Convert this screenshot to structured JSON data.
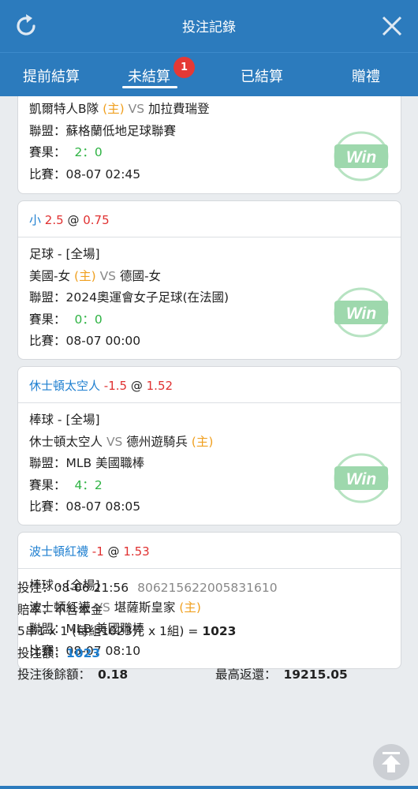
{
  "header": {
    "title": "投注記錄",
    "refresh_icon": "refresh-icon",
    "close_icon": "close-icon"
  },
  "tabs": [
    {
      "label": "提前結算",
      "active": false
    },
    {
      "label": "未結算",
      "active": true,
      "badge": "1"
    },
    {
      "label": "已結算",
      "active": false
    },
    {
      "label": "贈禮",
      "active": false
    }
  ],
  "card1": {
    "home": "凱爾特人B隊",
    "home_tag": "(主)",
    "vs": "VS",
    "away": "加拉費瑞登",
    "league_label": "聯盟：",
    "league": "蘇格蘭低地足球聯賽",
    "result_label": "賽果：",
    "result": "2：0",
    "time_label": "比賽：",
    "time": "08-07 02:45",
    "stamp": "Win"
  },
  "card2": {
    "pick": "小",
    "line": "2.5",
    "at": "@",
    "odds": "0.75",
    "sport": "足球 - [全場]",
    "home": "美國-女",
    "home_tag": "(主)",
    "vs": "VS",
    "away": "德國-女",
    "league_label": "聯盟：",
    "league": "2024奧運會女子足球(在法國)",
    "result_label": "賽果：",
    "result": "0：0",
    "time_label": "比賽：",
    "time": "08-07 00:00",
    "stamp": "Win"
  },
  "card3": {
    "pick": "休士頓太空人",
    "line": "-1.5",
    "at": "@",
    "odds": "1.52",
    "sport": "棒球 - [全場]",
    "home": "休士頓太空人",
    "vs": "VS",
    "away": "德州遊騎兵",
    "away_tag": "(主)",
    "league_label": "聯盟：",
    "league": "MLB 美國職棒",
    "result_label": "賽果：",
    "result": "4：2",
    "time_label": "比賽：",
    "time": "08-07 08:05",
    "stamp": "Win"
  },
  "card4": {
    "pick": "波士頓紅襪",
    "line": "-1",
    "at": "@",
    "odds": "1.53",
    "sport": "棒球 - [全場]",
    "home": "波士頓紅襪",
    "vs": "VS",
    "away": "堪薩斯皇家",
    "away_tag": "(主)",
    "league_label": "聯盟：",
    "league": "MLB 美國職棒",
    "time_label": "比賽：",
    "time": "08-07 08:10"
  },
  "summary": {
    "bet_label": "投注：",
    "bet_time": "08-06 21:56",
    "bet_id": "806215622005831610",
    "odds_label": "賠率：",
    "odds_value": "不含本金",
    "combo_text": "5串1 x 1 (每組1023元 x 1組) = ",
    "combo_total": "1023",
    "stake_label": "投注額：",
    "stake_value": "1023",
    "balance_label": "投注後餘額：",
    "balance_value": "0.18",
    "max_label": "最高返還：",
    "max_value": "19215.05",
    "scroll_icon": "arrow-up-icon"
  },
  "colors": {
    "header_bg": "#2c7bbd",
    "accent_blue": "#1e7fd0",
    "odds_red": "#e03131",
    "home_orange": "#f0a020",
    "result_green": "#2fb344",
    "stamp_green": "#9ed8ad"
  }
}
